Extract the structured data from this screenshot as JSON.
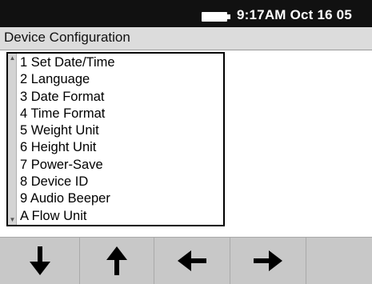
{
  "status_bar": {
    "clock": "9:17AM Oct 16 05",
    "battery_icon": "battery-icon"
  },
  "window": {
    "title": "Device Configuration"
  },
  "menu": {
    "items": [
      {
        "label": "1 Set Date/Time"
      },
      {
        "label": "2 Language"
      },
      {
        "label": "3 Date Format"
      },
      {
        "label": "4 Time Format"
      },
      {
        "label": "5 Weight Unit"
      },
      {
        "label": "6 Height Unit"
      },
      {
        "label": "7 Power-Save"
      },
      {
        "label": "8 Device ID"
      },
      {
        "label": "9 Audio Beeper"
      },
      {
        "label": "A Flow Unit"
      }
    ]
  },
  "softkeys": [
    {
      "icon": "arrow-down-icon"
    },
    {
      "icon": "arrow-up-icon"
    },
    {
      "icon": "arrow-left-icon"
    },
    {
      "icon": "arrow-right-icon"
    },
    {
      "icon": ""
    }
  ],
  "colors": {
    "status_bar_bg": "#111111",
    "title_bar_bg": "#dcdcdc",
    "softkey_bar_bg": "#c8c8c8"
  }
}
